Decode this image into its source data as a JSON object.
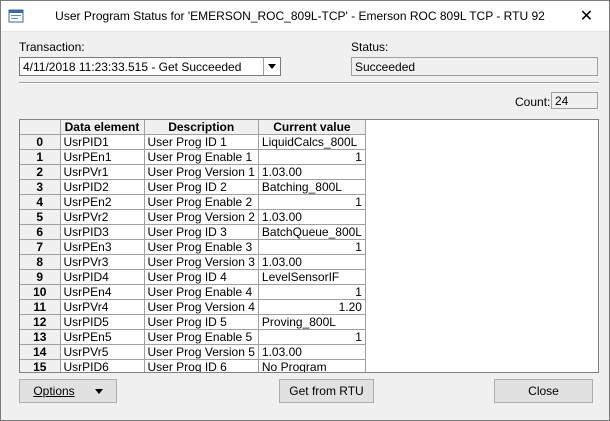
{
  "window": {
    "title": "User Program Status for 'EMERSON_ROC_809L-TCP' - Emerson ROC 809L TCP - RTU 92",
    "close_glyph": "✕"
  },
  "transaction": {
    "label": "Transaction:",
    "value": "4/11/2018 11:23:33.515 - Get Succeeded"
  },
  "status": {
    "label": "Status:",
    "value": "Succeeded"
  },
  "count": {
    "label": "Count:",
    "value": "24"
  },
  "grid": {
    "columns": [
      "",
      "Data element",
      "Description",
      "Current value"
    ],
    "rows": [
      {
        "idx": "0",
        "element": "UsrPID1",
        "desc": "User Prog ID 1",
        "value": "LiquidCalcs_800L",
        "align": "left"
      },
      {
        "idx": "1",
        "element": "UsrPEn1",
        "desc": "User Prog Enable 1",
        "value": "1",
        "align": "right"
      },
      {
        "idx": "2",
        "element": "UsrPVr1",
        "desc": "User Prog Version 1",
        "value": "1.03.00",
        "align": "left"
      },
      {
        "idx": "3",
        "element": "UsrPID2",
        "desc": "User Prog ID 2",
        "value": "Batching_800L",
        "align": "left"
      },
      {
        "idx": "4",
        "element": "UsrPEn2",
        "desc": "User Prog Enable 2",
        "value": "1",
        "align": "right"
      },
      {
        "idx": "5",
        "element": "UsrPVr2",
        "desc": "User Prog Version 2",
        "value": "1.03.00",
        "align": "left"
      },
      {
        "idx": "6",
        "element": "UsrPID3",
        "desc": "User Prog ID 3",
        "value": "BatchQueue_800L",
        "align": "left"
      },
      {
        "idx": "7",
        "element": "UsrPEn3",
        "desc": "User Prog Enable 3",
        "value": "1",
        "align": "right"
      },
      {
        "idx": "8",
        "element": "UsrPVr3",
        "desc": "User Prog Version 3",
        "value": "1.03.00",
        "align": "left"
      },
      {
        "idx": "9",
        "element": "UsrPID4",
        "desc": "User Prog ID 4",
        "value": "LevelSensorIF",
        "align": "left"
      },
      {
        "idx": "10",
        "element": "UsrPEn4",
        "desc": "User Prog Enable 4",
        "value": "1",
        "align": "right"
      },
      {
        "idx": "11",
        "element": "UsrPVr4",
        "desc": "User Prog Version 4",
        "value": "1.20",
        "align": "right"
      },
      {
        "idx": "12",
        "element": "UsrPID5",
        "desc": "User Prog ID 5",
        "value": "Proving_800L",
        "align": "left"
      },
      {
        "idx": "13",
        "element": "UsrPEn5",
        "desc": "User Prog Enable 5",
        "value": "1",
        "align": "right"
      },
      {
        "idx": "14",
        "element": "UsrPVr5",
        "desc": "User Prog Version 5",
        "value": "1.03.00",
        "align": "left"
      },
      {
        "idx": "15",
        "element": "UsrPID6",
        "desc": "User Prog ID 6",
        "value": "No Program",
        "align": "left"
      }
    ]
  },
  "buttons": {
    "options": "Options",
    "get_from_rtu": "Get from RTU",
    "close": "Close"
  }
}
